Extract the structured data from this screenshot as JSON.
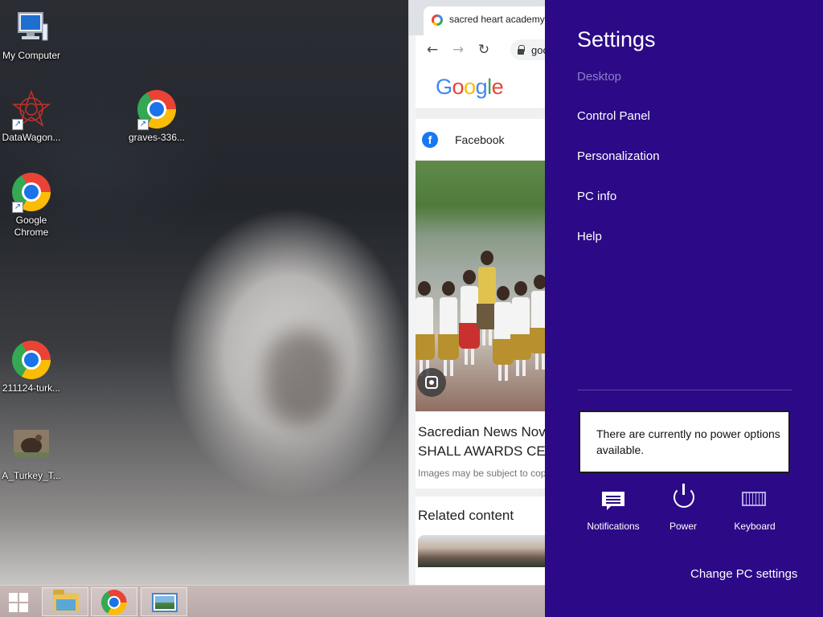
{
  "desktop": {
    "icons": [
      {
        "label": "My Computer"
      },
      {
        "label": "DataWagon..."
      },
      {
        "label": "graves-336..."
      },
      {
        "label": "Google Chrome"
      },
      {
        "label": "211124-turk..."
      },
      {
        "label": "A_Turkey_T..."
      }
    ]
  },
  "browser": {
    "tab_title": "sacred heart academy",
    "address": "goo",
    "google_logo": [
      "G",
      "o",
      "o",
      "g",
      "l",
      "e"
    ],
    "google_colors": [
      "#4285f4",
      "#ea4335",
      "#fbbc05",
      "#4285f4",
      "#34a853",
      "#ea4335"
    ],
    "facebook_icon": "f",
    "source_label": "Facebook",
    "article_title_line1": "Sacredian News Nov",
    "article_title_line2": "SHALL AWARDS CER",
    "image_note": "Images may be subject to cop",
    "related_title": "Related content"
  },
  "taskbar": {
    "items": [
      "file-explorer",
      "google-chrome",
      "photo-viewer"
    ]
  },
  "settings": {
    "title": "Settings",
    "context": "Desktop",
    "links": [
      "Control Panel",
      "Personalization",
      "PC info",
      "Help"
    ],
    "power_message": "There are currently no power options available.",
    "quick_actions": [
      {
        "label": "Notifications",
        "icon": "notifications-icon"
      },
      {
        "label": "Power",
        "icon": "power-icon"
      },
      {
        "label": "Keyboard",
        "icon": "keyboard-icon"
      }
    ],
    "change_pc_settings": "Change PC settings",
    "accent_color": "#2c0a87"
  }
}
